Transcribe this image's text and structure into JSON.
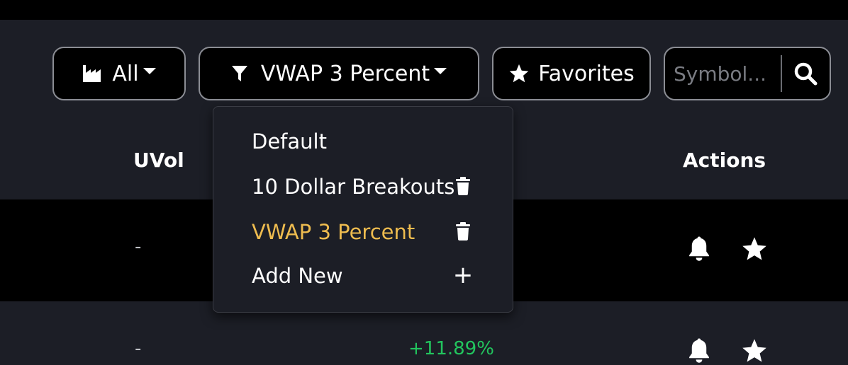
{
  "toolbar": {
    "category_label": "All",
    "category_icon": "industry-icon",
    "filter_label": "VWAP 3 Percent",
    "filter_icon": "filter-icon",
    "favorites_label": "Favorites",
    "favorites_icon": "star-icon"
  },
  "search": {
    "placeholder": "Symbol...",
    "value": "",
    "icon": "search-icon"
  },
  "table": {
    "columns": [
      {
        "label": "UVol"
      },
      {
        "label": ":"
      },
      {
        "label": "Actions"
      }
    ],
    "rows": [
      {
        "uvol": "-",
        "change": "",
        "actions": [
          "bell-icon",
          "star-icon"
        ]
      },
      {
        "uvol": "-",
        "change": "+11.89%",
        "actions": [
          "bell-icon",
          "star-icon"
        ]
      }
    ]
  },
  "filter_menu": {
    "items": [
      {
        "label": "Default",
        "action": ""
      },
      {
        "label": "10 Dollar Breakouts",
        "action": "trash-icon"
      },
      {
        "label": "VWAP 3 Percent",
        "action": "trash-icon",
        "active": true
      },
      {
        "label": "Add New",
        "action": "+"
      }
    ]
  },
  "colors": {
    "background": "#1c1e26",
    "row_dark": "#000000",
    "active_item": "#eebc4f",
    "positive": "#22c55e",
    "border": "#8b8d94"
  }
}
